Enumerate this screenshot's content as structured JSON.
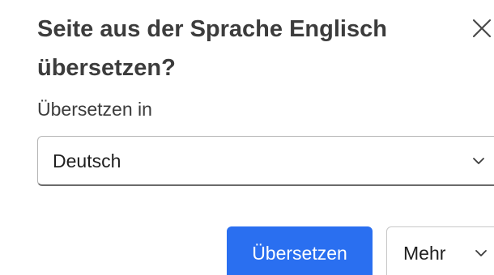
{
  "dialog": {
    "title": "Seite aus der Sprache Englisch übersetzen?",
    "close_icon": "close-icon"
  },
  "target_language": {
    "label": "Übersetzen in",
    "selected": "Deutsch",
    "chevron_icon": "chevron-down-icon"
  },
  "actions": {
    "translate_label": "Übersetzen",
    "more_label": "Mehr",
    "more_chevron_icon": "chevron-down-icon"
  },
  "colors": {
    "primary": "#2a6ff0",
    "text": "#3c3c3c",
    "border": "#b5b5b5"
  }
}
